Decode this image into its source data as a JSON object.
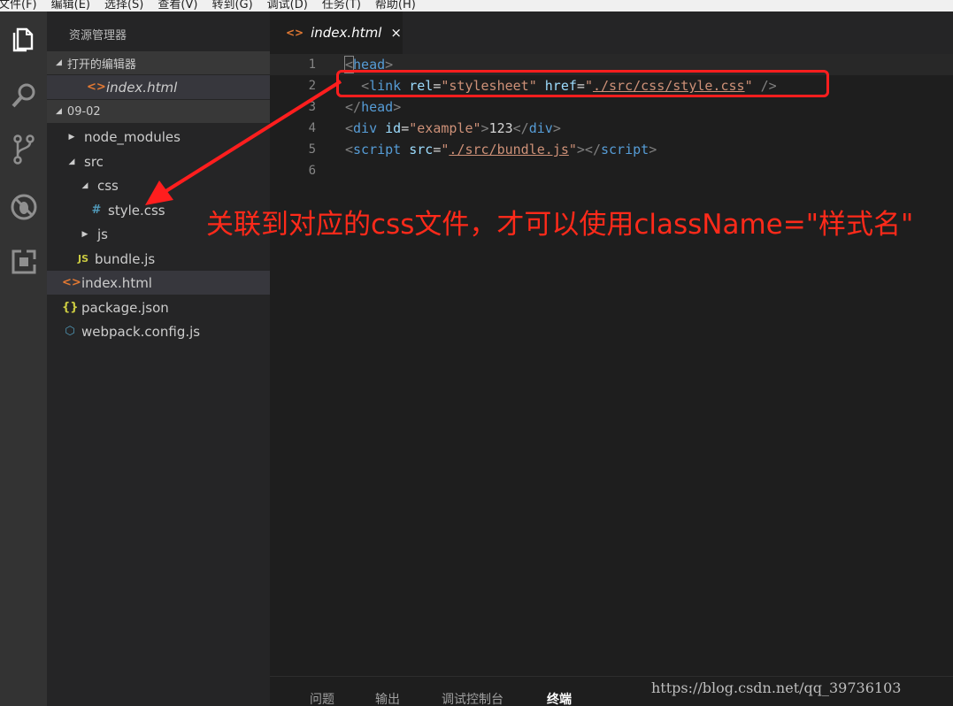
{
  "menu": [
    "文件(F)",
    "编辑(E)",
    "选择(S)",
    "查看(V)",
    "转到(G)",
    "调试(D)",
    "任务(T)",
    "帮助(H)"
  ],
  "activity_bar": [
    "files-icon",
    "search-icon",
    "source-control-icon",
    "debug-icon",
    "extensions-icon"
  ],
  "sidebar": {
    "title": "资源管理器",
    "open_editors": {
      "header": "打开的编辑器",
      "files": [
        {
          "name": "index.html",
          "icon": "html-icon"
        }
      ]
    },
    "folder": {
      "header": "09-02",
      "tree": [
        {
          "label": "node_modules",
          "type": "folder",
          "expanded": false
        },
        {
          "label": "src",
          "type": "folder",
          "expanded": true
        },
        {
          "label": "css",
          "type": "folder",
          "expanded": true
        },
        {
          "label": "style.css",
          "type": "file",
          "icon": "css-icon",
          "icon_glyph": "#"
        },
        {
          "label": "js",
          "type": "folder",
          "expanded": false
        },
        {
          "label": "bundle.js",
          "type": "file",
          "icon": "js-icon",
          "icon_glyph": "JS"
        },
        {
          "label": "index.html",
          "type": "file",
          "icon": "html-icon",
          "icon_glyph": "<>"
        },
        {
          "label": "package.json",
          "type": "file",
          "icon": "json-icon",
          "icon_glyph": "{}"
        },
        {
          "label": "webpack.config.js",
          "type": "file",
          "icon": "webpack-icon",
          "icon_glyph": "⬡"
        }
      ]
    }
  },
  "tab": {
    "label": "index.html",
    "close": "×",
    "icon_glyph": "<>"
  },
  "editor": {
    "line_numbers": [
      "1",
      "2",
      "3",
      "4",
      "5",
      "6"
    ],
    "lines": [
      [
        {
          "t": "<",
          "c": "pun"
        },
        {
          "t": "head",
          "c": "tag"
        },
        {
          "t": ">",
          "c": "pun"
        }
      ],
      [
        {
          "t": "  ",
          "c": "txt"
        },
        {
          "t": "<",
          "c": "pun"
        },
        {
          "t": "link",
          "c": "tag"
        },
        {
          "t": " ",
          "c": "txt"
        },
        {
          "t": "rel",
          "c": "attr"
        },
        {
          "t": "=",
          "c": "txt"
        },
        {
          "t": "\"stylesheet\"",
          "c": "str"
        },
        {
          "t": " ",
          "c": "txt"
        },
        {
          "t": "href",
          "c": "attr"
        },
        {
          "t": "=",
          "c": "txt"
        },
        {
          "t": "\"",
          "c": "str"
        },
        {
          "t": "./src/css/style.css",
          "c": "str-u"
        },
        {
          "t": "\"",
          "c": "str"
        },
        {
          "t": " />",
          "c": "pun"
        }
      ],
      [
        {
          "t": "</",
          "c": "pun"
        },
        {
          "t": "head",
          "c": "tag"
        },
        {
          "t": ">",
          "c": "pun"
        }
      ],
      [
        {
          "t": "<",
          "c": "pun"
        },
        {
          "t": "div",
          "c": "tag"
        },
        {
          "t": " ",
          "c": "txt"
        },
        {
          "t": "id",
          "c": "attr"
        },
        {
          "t": "=",
          "c": "txt"
        },
        {
          "t": "\"example\"",
          "c": "str"
        },
        {
          "t": ">",
          "c": "pun"
        },
        {
          "t": "123",
          "c": "txt"
        },
        {
          "t": "</",
          "c": "pun"
        },
        {
          "t": "div",
          "c": "tag"
        },
        {
          "t": ">",
          "c": "pun"
        }
      ],
      [
        {
          "t": "<",
          "c": "pun"
        },
        {
          "t": "script",
          "c": "tag"
        },
        {
          "t": " ",
          "c": "txt"
        },
        {
          "t": "src",
          "c": "attr"
        },
        {
          "t": "=",
          "c": "txt"
        },
        {
          "t": "\"",
          "c": "str"
        },
        {
          "t": "./src/bundle.js",
          "c": "str-u"
        },
        {
          "t": "\"",
          "c": "str"
        },
        {
          "t": "></",
          "c": "pun"
        },
        {
          "t": "script",
          "c": "tag"
        },
        {
          "t": ">",
          "c": "pun"
        }
      ],
      []
    ]
  },
  "annotation": "关联到对应的css文件，才可以使用className=\"样式名\"",
  "panel_tabs": [
    {
      "label": "问题",
      "active": false
    },
    {
      "label": "输出",
      "active": false
    },
    {
      "label": "调试控制台",
      "active": false
    },
    {
      "label": "终端",
      "active": true
    }
  ],
  "watermark": "https://blog.csdn.net/qq_39736103",
  "colors": {
    "annotation": "#ff2a1a",
    "tag": "#569cd6",
    "attr": "#9cdcfe",
    "string": "#ce9178"
  }
}
